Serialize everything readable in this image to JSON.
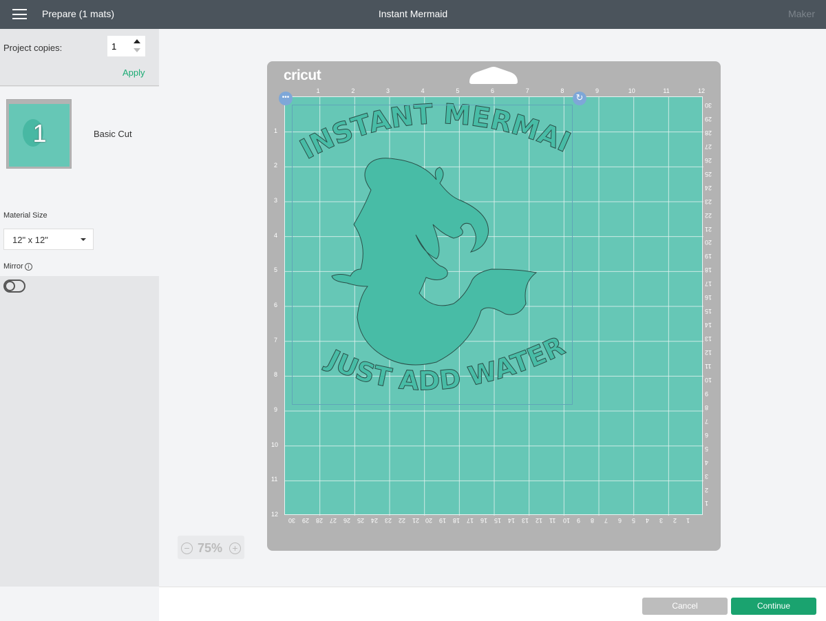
{
  "header": {
    "menu_icon": "hamburger-icon",
    "left_title": "Prepare (1 mats)",
    "title": "Instant Mermaid",
    "right_label": "Maker"
  },
  "sidebar": {
    "copies_label": "Project copies:",
    "copies_value": "1",
    "apply_label": "Apply",
    "mat": {
      "number": "1",
      "type": "Basic Cut"
    },
    "material_size_label": "Material Size",
    "material_size_value": "12\" x 12\"",
    "mirror_label": "Mirror",
    "mirror_on": false
  },
  "mat": {
    "logo": "cricut",
    "top_ruler": [
      "1",
      "2",
      "3",
      "4",
      "5",
      "6",
      "7",
      "8",
      "9",
      "10",
      "11",
      "12"
    ],
    "left_ruler": [
      "1",
      "2",
      "3",
      "4",
      "5",
      "6",
      "7",
      "8",
      "9",
      "10",
      "11",
      "12"
    ],
    "right_ruler": [
      "30",
      "29",
      "28",
      "27",
      "26",
      "25",
      "24",
      "23",
      "22",
      "21",
      "20",
      "19",
      "18",
      "17",
      "16",
      "15",
      "14",
      "13",
      "12",
      "11",
      "10",
      "9",
      "8",
      "7",
      "6",
      "5",
      "4",
      "3",
      "2",
      "1"
    ],
    "bottom_ruler": [
      "30",
      "29",
      "28",
      "27",
      "26",
      "25",
      "24",
      "23",
      "22",
      "21",
      "20",
      "19",
      "18",
      "17",
      "16",
      "15",
      "14",
      "13",
      "12",
      "11",
      "10",
      "9",
      "8",
      "7",
      "6",
      "5",
      "4",
      "3",
      "2",
      "1"
    ],
    "design_text_top": "INSTANT MERMAID",
    "design_text_bottom": "JUST ADD WATER",
    "mat_color": "#66c7b6",
    "design_color": "#48bca6"
  },
  "zoom": {
    "value": "75%"
  },
  "footer": {
    "cancel_label": "Cancel",
    "continue_label": "Continue",
    "accent": "#1aa36f"
  }
}
